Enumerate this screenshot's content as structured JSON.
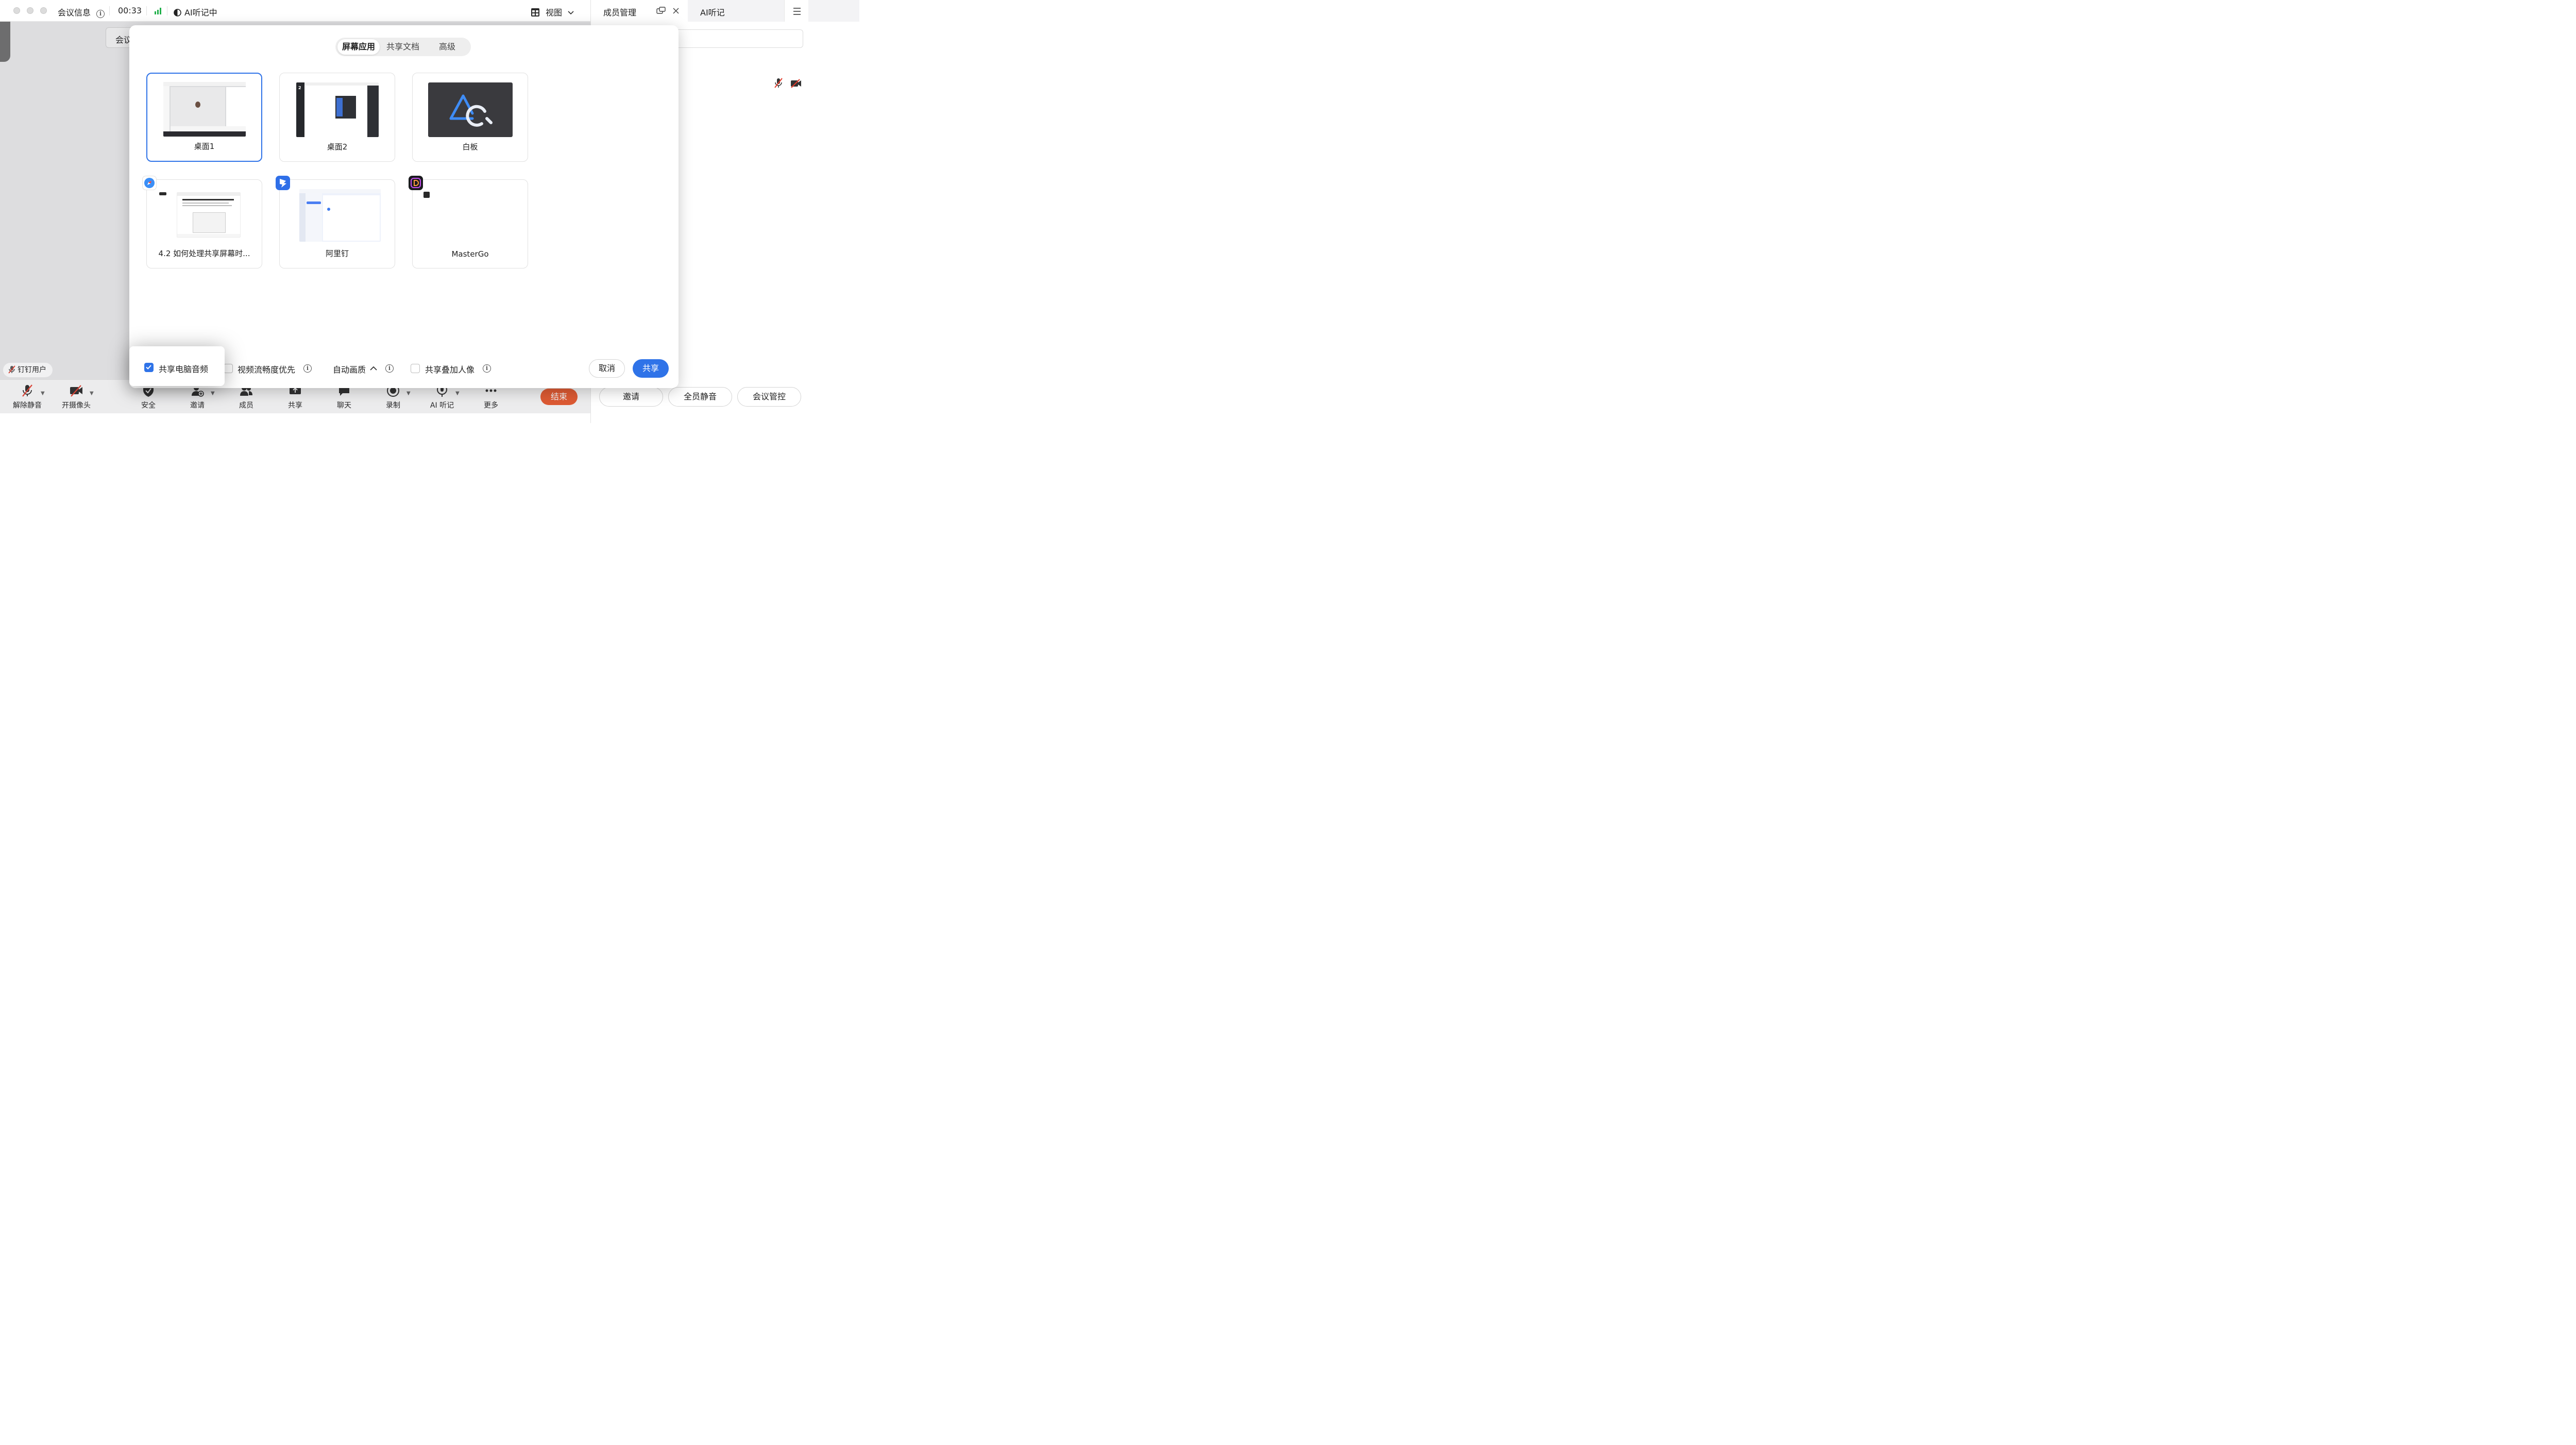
{
  "titlebar": {
    "meeting_info": "会议信息",
    "timer": "00:33",
    "ai_status": "AI听记中",
    "view": "视图"
  },
  "right_panel": {
    "tab_members": "成员管理",
    "tab_ai": "AI听记",
    "buttons": {
      "invite": "邀请",
      "mute_all": "全员静音",
      "meeting_control": "会议管控"
    }
  },
  "stage": {
    "meeting_info_chip": "会议",
    "user_name": "钉钉用户"
  },
  "toolbar": {
    "items": [
      {
        "label": "解除静音",
        "icon": "mic-off-icon"
      },
      {
        "label": "开摄像头",
        "icon": "camera-off-icon"
      },
      {
        "label": "安全",
        "icon": "shield-icon"
      },
      {
        "label": "邀请",
        "icon": "invite-icon"
      },
      {
        "label": "成员",
        "icon": "members-icon"
      },
      {
        "label": "共享",
        "icon": "share-icon"
      },
      {
        "label": "聊天",
        "icon": "chat-icon"
      },
      {
        "label": "录制",
        "icon": "record-icon"
      },
      {
        "label": "AI 听记",
        "icon": "ai-record-icon"
      },
      {
        "label": "更多",
        "icon": "more-icon"
      }
    ],
    "end": "结束"
  },
  "dialog": {
    "tabs": [
      "屏幕应用",
      "共享文档",
      "高级"
    ],
    "active_tab": 0,
    "cards": [
      {
        "caption": "桌面1",
        "selected": true
      },
      {
        "caption": "桌面2",
        "selected": false
      },
      {
        "caption": "白板",
        "selected": false
      },
      {
        "caption": "4.2 如何处理共享屏幕时...",
        "selected": false
      },
      {
        "caption": "阿里钉",
        "selected": false
      },
      {
        "caption": "MasterGo",
        "selected": false
      }
    ],
    "options": {
      "share_audio": "共享电脑音频",
      "share_audio_checked": true,
      "smooth": "视频流畅度优先",
      "smooth_checked": false,
      "quality": "自动画质",
      "overlay": "共享叠加人像",
      "overlay_checked": false
    },
    "cancel": "取消",
    "share": "共享"
  },
  "colors": {
    "accent": "#2f73e8",
    "end": "#e8572b",
    "mute_red": "#e23c2c",
    "signal": "#22b04b"
  }
}
